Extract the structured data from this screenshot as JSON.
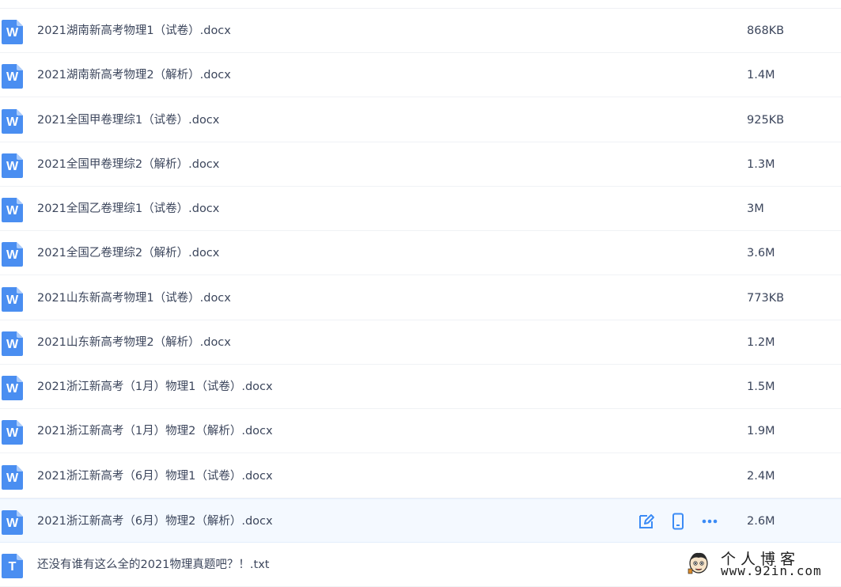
{
  "colors": {
    "word_icon": "#4a8ef1",
    "txt_icon": "#4a8ef1",
    "action_icon": "#3b8bf5",
    "hover_row": "#f4f9ff"
  },
  "files": [
    {
      "name": "2021湖南新高考物理1（试卷）.docx",
      "size": "868KB",
      "type": "word",
      "icon_letter": "W"
    },
    {
      "name": "2021湖南新高考物理2（解析）.docx",
      "size": "1.4M",
      "type": "word",
      "icon_letter": "W"
    },
    {
      "name": "2021全国甲卷理综1（试卷）.docx",
      "size": "925KB",
      "type": "word",
      "icon_letter": "W"
    },
    {
      "name": "2021全国甲卷理综2（解析）.docx",
      "size": "1.3M",
      "type": "word",
      "icon_letter": "W"
    },
    {
      "name": "2021全国乙卷理综1（试卷）.docx",
      "size": "3M",
      "type": "word",
      "icon_letter": "W"
    },
    {
      "name": "2021全国乙卷理综2（解析）.docx",
      "size": "3.6M",
      "type": "word",
      "icon_letter": "W"
    },
    {
      "name": "2021山东新高考物理1（试卷）.docx",
      "size": "773KB",
      "type": "word",
      "icon_letter": "W"
    },
    {
      "name": "2021山东新高考物理2（解析）.docx",
      "size": "1.2M",
      "type": "word",
      "icon_letter": "W"
    },
    {
      "name": "2021浙江新高考（1月）物理1（试卷）.docx",
      "size": "1.5M",
      "type": "word",
      "icon_letter": "W"
    },
    {
      "name": "2021浙江新高考（1月）物理2（解析）.docx",
      "size": "1.9M",
      "type": "word",
      "icon_letter": "W"
    },
    {
      "name": "2021浙江新高考（6月）物理1（试卷）.docx",
      "size": "2.4M",
      "type": "word",
      "icon_letter": "W"
    },
    {
      "name": "2021浙江新高考（6月）物理2（解析）.docx",
      "size": "2.6M",
      "type": "word",
      "icon_letter": "W",
      "hovered": true
    },
    {
      "name": "还没有谁有这么全的2021物理真题吧？！.txt",
      "size": "",
      "type": "txt",
      "icon_letter": "T"
    }
  ],
  "row_actions": [
    {
      "icon": "edit-icon"
    },
    {
      "icon": "phone-icon"
    },
    {
      "icon": "more-icon"
    }
  ],
  "watermark": {
    "line1": "个人博客",
    "line2": "www.92in.com",
    "icon": "cartoon-face-logo"
  }
}
